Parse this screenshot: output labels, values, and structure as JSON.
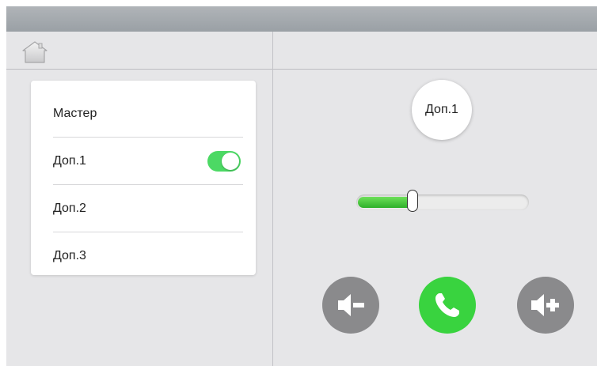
{
  "header": {
    "home_icon": "home-icon"
  },
  "menu": {
    "items": [
      {
        "label": "Мастер",
        "toggle": false
      },
      {
        "label": "Доп.1",
        "toggle": true
      },
      {
        "label": "Доп.2",
        "toggle": false
      },
      {
        "label": "Доп.3",
        "toggle": false
      }
    ]
  },
  "channel": {
    "label": "Доп.1"
  },
  "volume": {
    "level_fraction": 0.31
  },
  "controls": {
    "volume_down_icon": "volume-down-icon",
    "call_icon": "phone-call-icon",
    "volume_up_icon": "volume-up-icon"
  },
  "colors": {
    "accent_green": "#39d33f",
    "toggle_green": "#4cd964",
    "button_gray": "#8a8a8c"
  }
}
